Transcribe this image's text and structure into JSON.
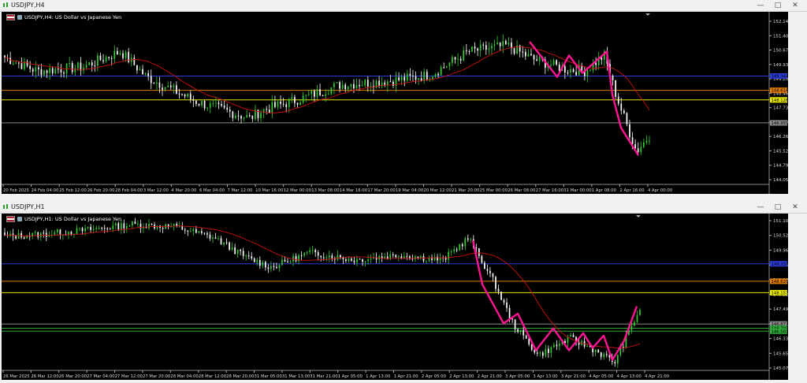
{
  "colors": {
    "background": "#000000",
    "bull": "#32cd32",
    "bear": "#ffffff",
    "ma": "#cc1111",
    "zigzag": "#ff1493",
    "blue_line": "#2a3bd6",
    "orange_line": "#e07b00",
    "yellow_line": "#e8e800",
    "green_line": "#2fa83a",
    "gray_line": "#8a8a8a"
  },
  "window_h4": {
    "title": "USDJPY,H4",
    "chart_label": "USDJPY,H4:  US Dollar vs Japanese Yen",
    "minimize": "—",
    "restore": "□",
    "close": "✕",
    "price_ticks": [
      "152.140",
      "151.405",
      "150.670",
      "149.935",
      "149.200",
      "148.465",
      "147.730",
      "146.995",
      "146.260",
      "145.525",
      "144.790",
      "144.055"
    ],
    "level_tags": [
      {
        "label": "149.344",
        "color": "#2a3bd6",
        "price": 149.344
      },
      {
        "label": "148.616",
        "color": "#e07b00",
        "price": 148.616
      },
      {
        "label": "148.126",
        "color": "#e8e800",
        "price": 148.126
      },
      {
        "label": "146.955",
        "color": "#8a8a8a",
        "price": 146.955
      }
    ],
    "time_ticks": [
      "20 Feb 2025",
      "24 Feb 04:00",
      "25 Feb 12:00",
      "26 Feb 20:00",
      "28 Feb 04:00",
      "3 Mar 12:00",
      "4 Mar 20:00",
      "6 Mar 04:00",
      "7 Mar 12:00",
      "10 Mar 16:00",
      "12 Mar 00:00",
      "13 Mar 08:00",
      "14 Mar 16:00",
      "17 Mar 20:00",
      "19 Mar 04:00",
      "20 Mar 12:00",
      "21 Mar 20:00",
      "25 Mar 00:00",
      "26 Mar 08:00",
      "27 Mar 16:00",
      "31 Mar 00:00",
      "1 Apr 08:00",
      "2 Apr 16:00",
      "4 Apr 00:00"
    ]
  },
  "window_h1": {
    "title": "USDJPY,H1",
    "chart_label": "USDJPY,H1:  US Dollar vs Japanese Yen",
    "minimize": "—",
    "restore": "□",
    "close": "✕",
    "price_ticks": [
      "151.105",
      "150.525",
      "149.965",
      "149.385",
      "148.805",
      "148.225",
      "147.495",
      "146.915",
      "146.335",
      "145.655",
      "145.075"
    ],
    "level_tags": [
      {
        "label": "149.339",
        "color": "#2a3bd6",
        "price": 149.339
      },
      {
        "label": "148.625",
        "color": "#e07b00",
        "price": 148.625
      },
      {
        "label": "148.157",
        "color": "#e8e800",
        "price": 148.157
      },
      {
        "label": "146.877",
        "color": "#8a8a8a",
        "price": 146.877
      },
      {
        "label": "146.705",
        "color": "#2fa83a",
        "price": 146.705
      },
      {
        "label": "146.581",
        "color": "#2fa83a",
        "price": 146.581
      }
    ],
    "time_ticks": [
      "26 Mar 2025",
      "26 Mar 12:00",
      "26 Mar 20:00",
      "27 Mar 04:00",
      "27 Mar 12:00",
      "27 Mar 20:00",
      "28 Mar 04:00",
      "28 Mar 12:00",
      "28 Mar 20:00",
      "31 Mar 05:00",
      "31 Mar 13:00",
      "31 Mar 21:00",
      "1 Apr 05:00",
      "1 Apr 13:00",
      "1 Apr 21:00",
      "2 Apr 05:00",
      "2 Apr 13:00",
      "2 Apr 21:00",
      "3 Apr 05:00",
      "3 Apr 13:00",
      "3 Apr 21:00",
      "4 Apr 05:00",
      "4 Apr 13:00",
      "4 Apr 21:00"
    ]
  }
}
